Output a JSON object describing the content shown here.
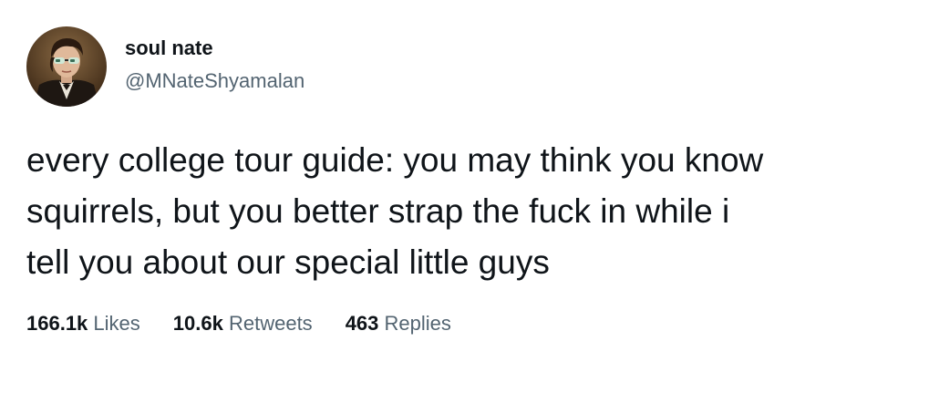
{
  "author": {
    "display_name": "soul nate",
    "handle": "@MNateShyamalan",
    "avatar_icon": "portrait-avatar-icon"
  },
  "tweet": {
    "text_lines": [
      "every college tour guide: you may think you know",
      "squirrels, but you better strap the fuck in while i",
      "tell you about our special little guys"
    ]
  },
  "stats": {
    "likes": {
      "count": "166.1k",
      "label": "Likes"
    },
    "retweets": {
      "count": "10.6k",
      "label": "Retweets"
    },
    "replies": {
      "count": "463",
      "label": "Replies"
    }
  },
  "colors": {
    "text_primary": "#0f1419",
    "text_secondary": "#536471",
    "background": "#ffffff"
  }
}
